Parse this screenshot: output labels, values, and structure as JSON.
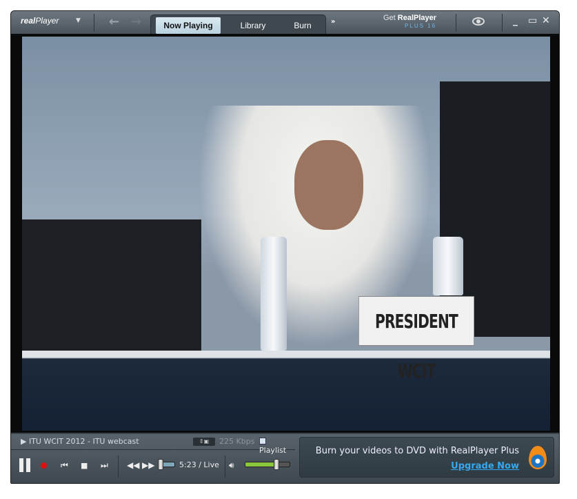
{
  "titlebar": {
    "logo_real": "real",
    "logo_player": "Player",
    "tabs": [
      {
        "label": "Now Playing",
        "active": true
      },
      {
        "label": "Library"
      },
      {
        "label": "Burn"
      }
    ],
    "get_text": "Get ",
    "get_brand": "RealPlayer",
    "get_plus": "PLUS 16"
  },
  "video": {
    "placard": "PRESIDENT WCIT"
  },
  "player": {
    "clip_title": "ITU WCIT 2012 - ITU webcast",
    "bitrate": "225 Kbps",
    "playlist_label": "Playlist",
    "time": "5:23 / Live",
    "progress": 0.05,
    "volume": 0.7
  },
  "promo": {
    "message": "Burn your videos to DVD with RealPlayer Plus",
    "link": "Upgrade Now"
  },
  "colors": {
    "accent": "#33aaf0",
    "record": "#e01010",
    "volume": "#8bc63f"
  }
}
